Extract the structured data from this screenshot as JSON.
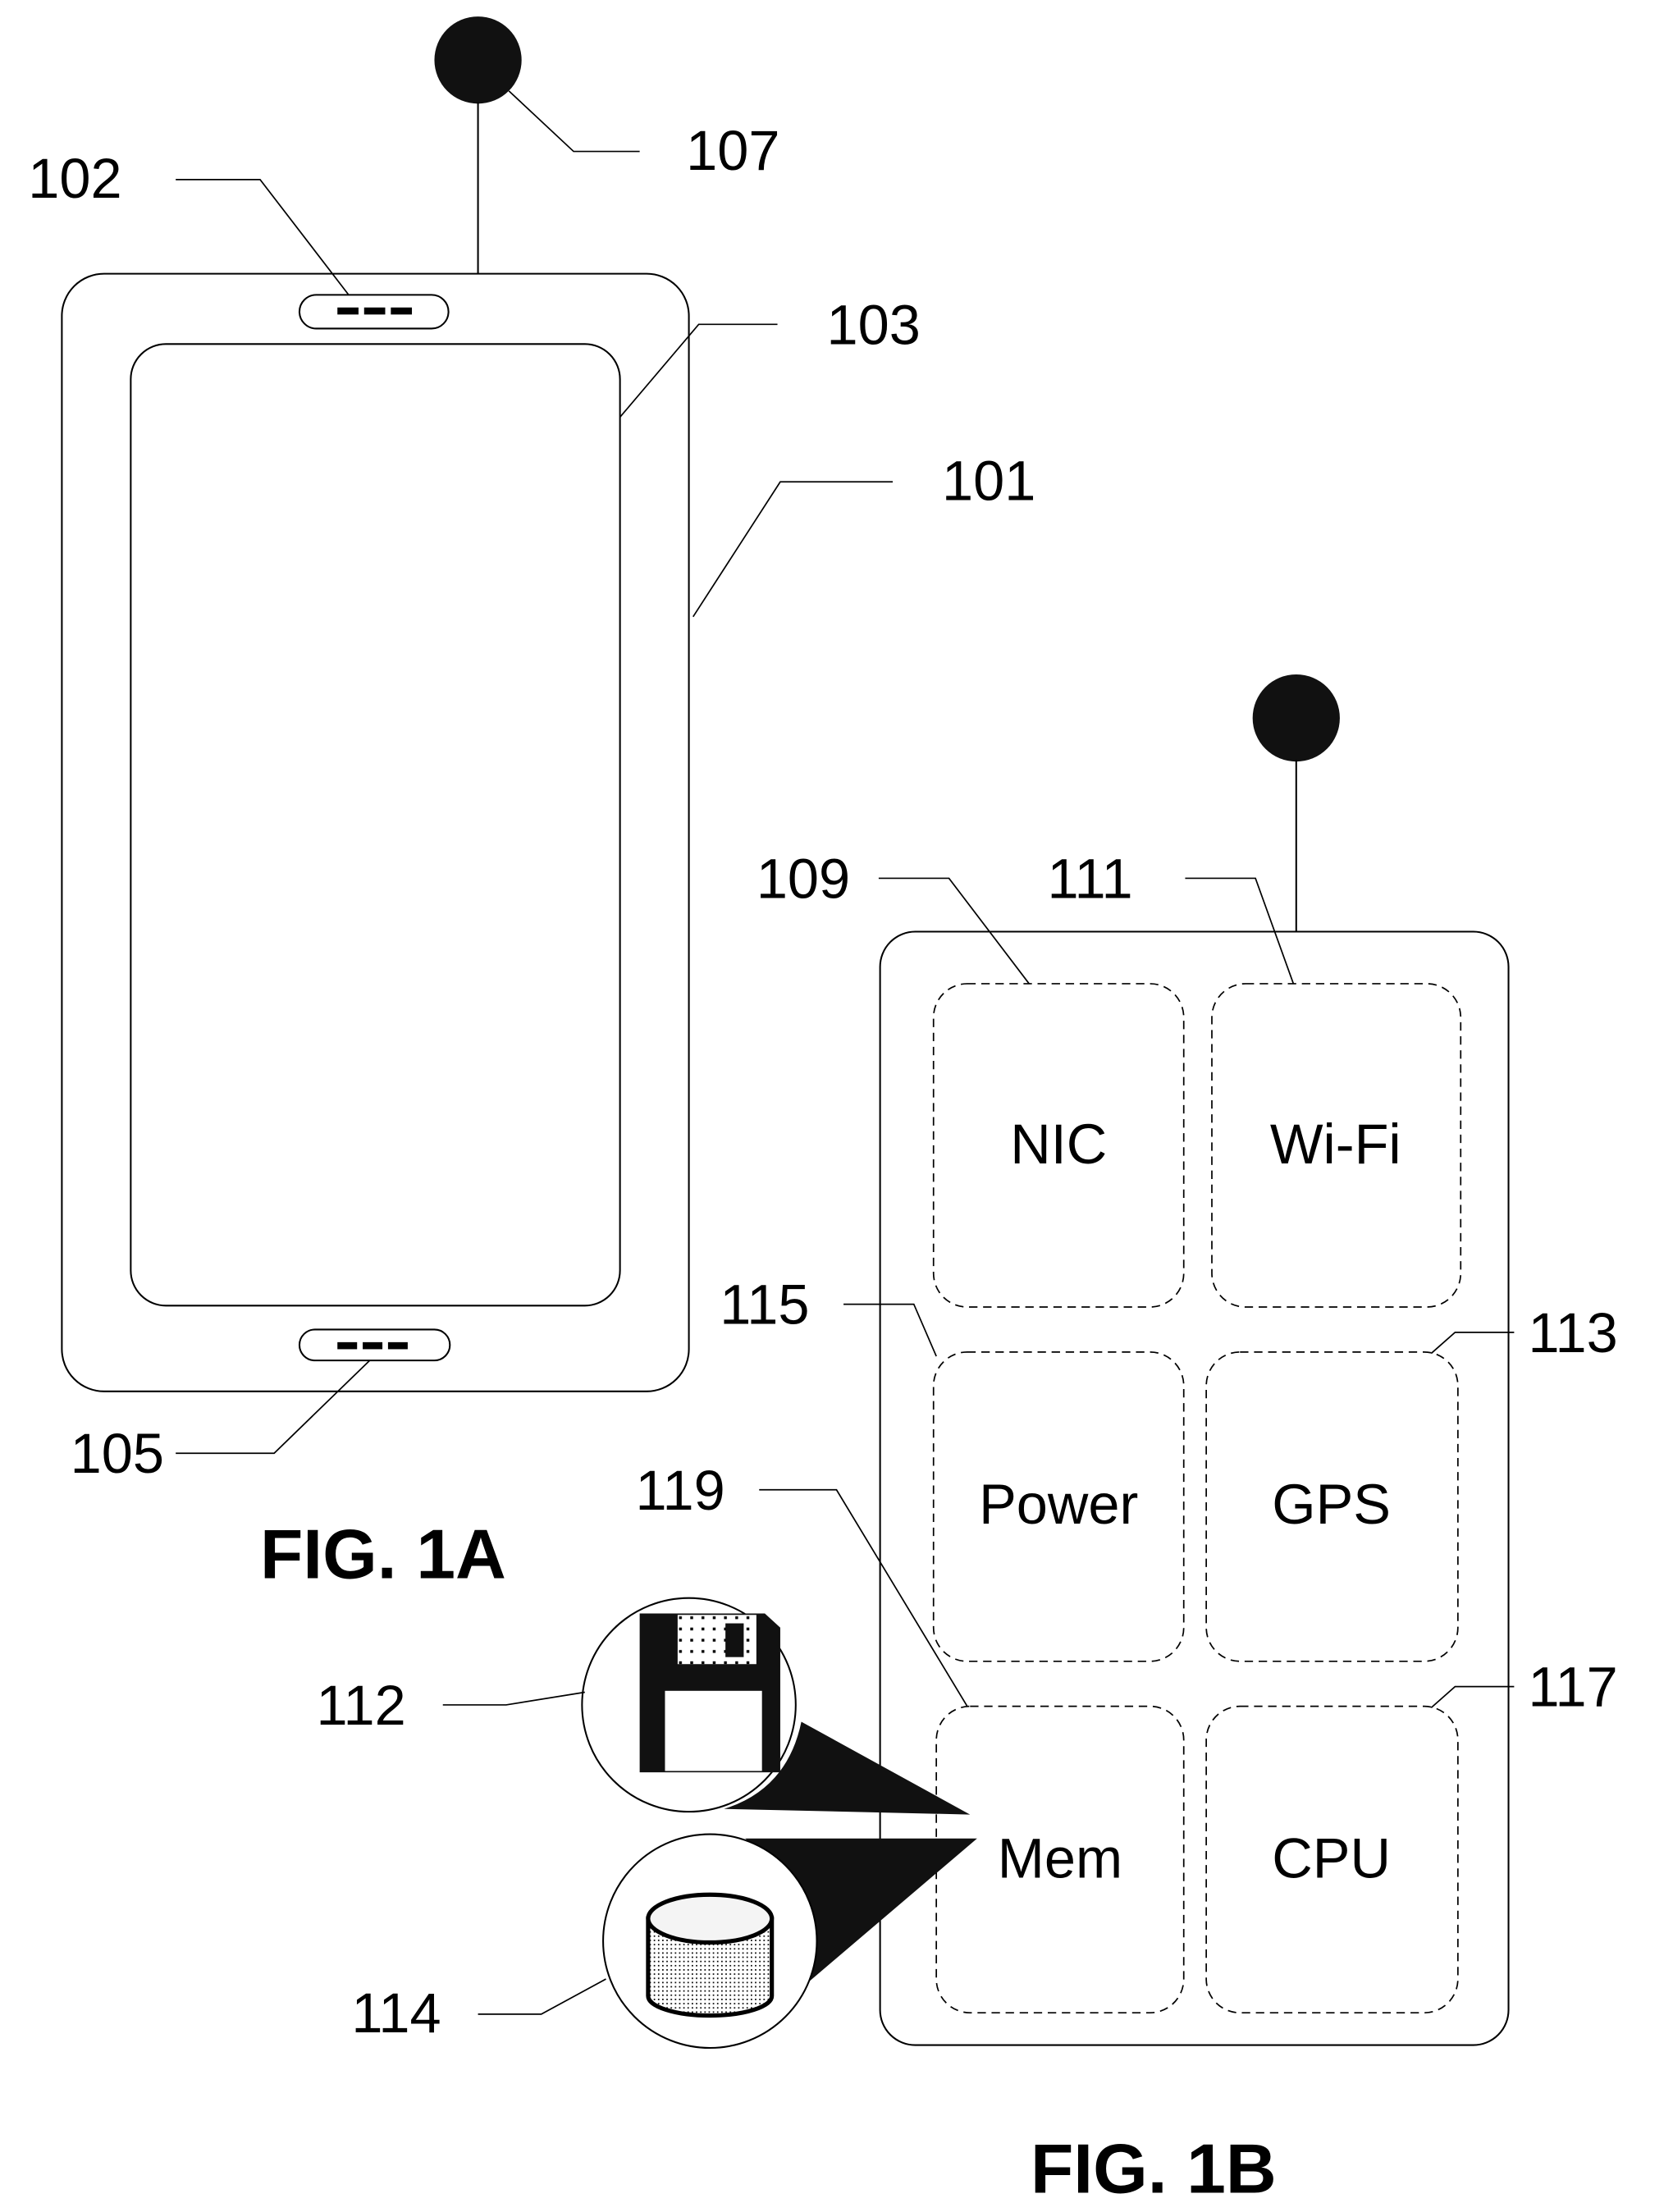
{
  "figures": {
    "fig_1a": {
      "title": "FIG. 1A",
      "refs": {
        "device": "101",
        "earpiece": "102",
        "screen": "103",
        "bottom_port": "105",
        "antenna": "107"
      }
    },
    "fig_1b": {
      "title": "FIG. 1B",
      "components": [
        {
          "label": "NIC",
          "ref": "109"
        },
        {
          "label": "Wi-Fi",
          "ref": "111"
        },
        {
          "label": "Power",
          "ref": "115"
        },
        {
          "label": "GPS",
          "ref": "113"
        },
        {
          "label": "Mem",
          "ref": "119"
        },
        {
          "label": "CPU",
          "ref": "117"
        }
      ],
      "storage_refs": {
        "floppy": "112",
        "disk": "114"
      }
    }
  }
}
